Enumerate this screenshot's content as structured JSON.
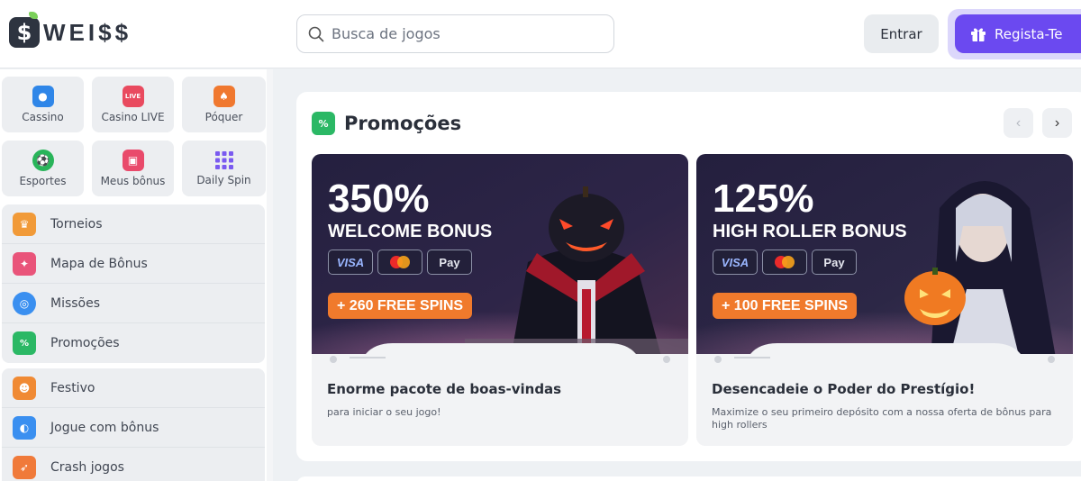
{
  "header": {
    "logo_text": "WEI$$",
    "logo_symbol": "$",
    "search_placeholder": "Busca de jogos",
    "login_label": "Entrar",
    "register_label": "Regista-Te"
  },
  "sidebar": {
    "tiles": [
      {
        "label": "Cassino",
        "icon": "casino-icon",
        "color": "#2f86e8"
      },
      {
        "label": "Casino LIVE",
        "icon": "live-casino-icon",
        "color": "#e94a5f",
        "badge": "LIVE"
      },
      {
        "label": "Póquer",
        "icon": "poker-icon",
        "color": "#f0782f"
      },
      {
        "label": "Esportes",
        "icon": "sports-icon",
        "color": "#29b45a"
      },
      {
        "label": "Meus bônus",
        "icon": "gift-icon",
        "color": "#e94a6b"
      },
      {
        "label": "Daily Spin",
        "icon": "daily-spin-icon",
        "color": "#7a5af0"
      }
    ],
    "menu1": [
      {
        "label": "Torneios",
        "icon": "trophy-icon",
        "color": "#f19a38"
      },
      {
        "label": "Mapa de Bônus",
        "icon": "bonus-map-icon",
        "color": "#e9547a"
      },
      {
        "label": "Missões",
        "icon": "target-icon",
        "color": "#3a8ff0"
      },
      {
        "label": "Promoções",
        "icon": "promotions-icon",
        "color": "#2bb865"
      }
    ],
    "menu2": [
      {
        "label": "Festivo",
        "icon": "festive-icon",
        "color": "#f08a34"
      },
      {
        "label": "Jogue com bônus",
        "icon": "play-bonus-icon",
        "color": "#3a8ff0"
      },
      {
        "label": "Crash jogos",
        "icon": "rocket-icon",
        "color": "#f07a3a"
      }
    ]
  },
  "main": {
    "section_title": "Promoções",
    "cards": [
      {
        "percent": "350%",
        "bonus_name": "WELCOME BONUS",
        "spins": "+ 260 FREE SPINS",
        "title": "Enorme pacote de boas-vindas",
        "description": "para iniciar o seu jogo!"
      },
      {
        "percent": "125%",
        "bonus_name": "HIGH ROLLER BONUS",
        "spins": "+ 100 FREE SPINS",
        "title": "Desencadeie o Poder do Prestígio!",
        "description": "Maximize o seu primeiro depósito com a nossa oferta de bônus para high rollers"
      }
    ],
    "payment_methods": [
      "VISA",
      "mastercard",
      "Pay"
    ]
  },
  "colors": {
    "accent": "#6b49f0",
    "spins_button": "#f07a2c",
    "banner_bg": "#1d1a3a"
  }
}
